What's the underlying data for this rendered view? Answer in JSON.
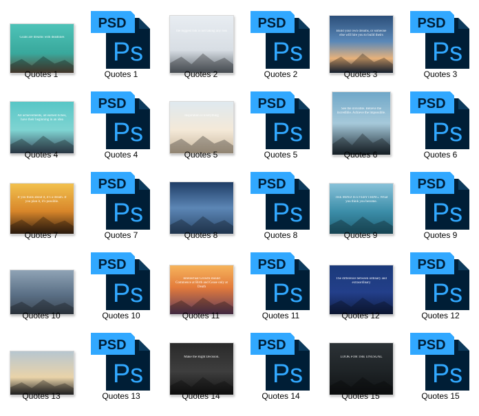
{
  "colors": {
    "psd_tab": "#31a8ff",
    "psd_body": "#001e36",
    "psd_text": "#31a8ff"
  },
  "psd_badge_text": "PSD",
  "ps_text": "Ps",
  "files": [
    {
      "label": "Quotes 1",
      "kind": "jpg",
      "thumb": "mountain-teal"
    },
    {
      "label": "Quotes 1",
      "kind": "psd"
    },
    {
      "label": "Quotes 2",
      "kind": "jpg",
      "thumb": "business-team"
    },
    {
      "label": "Quotes 2",
      "kind": "psd"
    },
    {
      "label": "Quotes 3",
      "kind": "jpg",
      "thumb": "sky-sunset"
    },
    {
      "label": "Quotes 3",
      "kind": "psd"
    },
    {
      "label": "Quotes 4",
      "kind": "jpg",
      "thumb": "mountain-flag"
    },
    {
      "label": "Quotes 4",
      "kind": "psd"
    },
    {
      "label": "Quotes 5",
      "kind": "jpg",
      "thumb": "woman-arms"
    },
    {
      "label": "Quotes 5",
      "kind": "psd"
    },
    {
      "label": "Quotes 6",
      "kind": "jpg",
      "thumb": "man-arms-sky"
    },
    {
      "label": "Quotes 6",
      "kind": "psd"
    },
    {
      "label": "Quotes 7",
      "kind": "jpg",
      "thumb": "golden-sunset"
    },
    {
      "label": "Quotes 7",
      "kind": "psd"
    },
    {
      "label": "Quotes 8",
      "kind": "jpg",
      "thumb": "paraglider"
    },
    {
      "label": "Quotes 8",
      "kind": "psd"
    },
    {
      "label": "Quotes 9",
      "kind": "jpg",
      "thumb": "sea-waves"
    },
    {
      "label": "Quotes 9",
      "kind": "psd"
    },
    {
      "label": "Quotes 10",
      "kind": "jpg",
      "thumb": "road"
    },
    {
      "label": "Quotes 10",
      "kind": "psd"
    },
    {
      "label": "Quotes 11",
      "kind": "jpg",
      "thumb": "clouds-sunset"
    },
    {
      "label": "Quotes 11",
      "kind": "psd"
    },
    {
      "label": "Quotes 12",
      "kind": "jpg",
      "thumb": "blue-man"
    },
    {
      "label": "Quotes 12",
      "kind": "psd"
    },
    {
      "label": "Quotes 13",
      "kind": "jpg",
      "thumb": "team-silhouette"
    },
    {
      "label": "Quotes 13",
      "kind": "psd"
    },
    {
      "label": "Quotes 14",
      "kind": "jpg",
      "thumb": "dark-handshake"
    },
    {
      "label": "Quotes 14",
      "kind": "psd"
    },
    {
      "label": "Quotes 15",
      "kind": "jpg",
      "thumb": "dark-typography"
    },
    {
      "label": "Quotes 15",
      "kind": "psd"
    }
  ],
  "thumb_text": {
    "mountain-teal": "Goals are dreams with deadlines",
    "business-team": "the biggest risk is not taking any risk",
    "sky-sunset": "Build your own dreams, or someone else will hire you to build theirs",
    "mountain-flag": "All achievements, all earned riches, have their beginning in an idea",
    "woman-arms": "Inspiration is Everything",
    "man-arms-sky": "See the invisible. Believe the incredible. Achieve the impossible.",
    "golden-sunset": "If you think about it, it's a dream. If you plan it, it's possible.",
    "paraglider": "",
    "sea-waves": "THE MIND IS EVERYTHING. What you think you become.",
    "road": "",
    "clouds-sunset": "Intellectual Growth should Commence at Birth and Cease only at Death",
    "blue-man": "The difference between ordinary and extraordinary",
    "team-silhouette": "",
    "dark-handshake": "Make the Right Decision.",
    "dark-typography": "LOOK FOR THE UNUSUAL"
  }
}
